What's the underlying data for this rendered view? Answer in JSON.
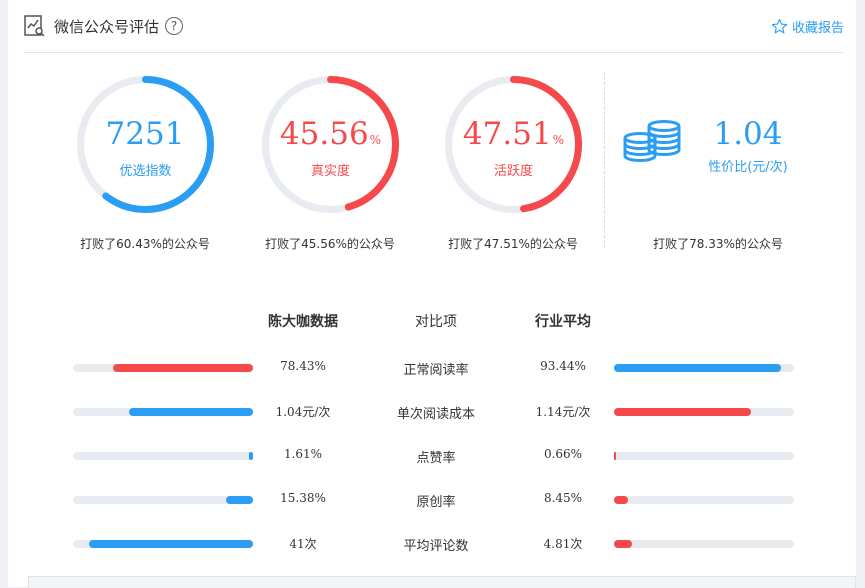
{
  "header": {
    "title": "微信公众号评估",
    "help_glyph": "?",
    "favorite_label": "收藏报告"
  },
  "colors": {
    "blue": "#2a9df4",
    "red": "#f5494b",
    "track": "#e8ebf0"
  },
  "gauges": [
    {
      "value": "7251",
      "unit": "",
      "label": "优选指数",
      "fraction": 0.6043,
      "color": "#2a9df4",
      "beat": "打败了60.43%的公众号"
    },
    {
      "value": "45.56",
      "unit": "%",
      "label": "真实度",
      "fraction": 0.4556,
      "color": "#f5494b",
      "beat": "打败了45.56%的公众号"
    },
    {
      "value": "47.51",
      "unit": "%",
      "label": "活跃度",
      "fraction": 0.4751,
      "color": "#f5494b",
      "beat": "打败了47.51%的公众号"
    }
  ],
  "cost": {
    "value": "1.04",
    "label": "性价比(元/次)",
    "beat": "打败了78.33%的公众号",
    "icon": "coins-stack-icon"
  },
  "compare": {
    "headers": {
      "own": "陈大咖数据",
      "metric": "对比项",
      "avg": "行业平均"
    },
    "rows": [
      {
        "own": "78.43%",
        "metric": "正常阅读率",
        "avg": "93.44%",
        "own_fill": 0.78,
        "own_color": "#f5494b",
        "avg_fill": 0.93,
        "avg_color": "#2a9df4"
      },
      {
        "own": "1.04元/次",
        "metric": "单次阅读成本",
        "avg": "1.14元/次",
        "own_fill": 0.69,
        "own_color": "#2a9df4",
        "avg_fill": 0.76,
        "avg_color": "#f5494b"
      },
      {
        "own": "1.61%",
        "metric": "点赞率",
        "avg": "0.66%",
        "own_fill": 0.02,
        "own_color": "#2a9df4",
        "avg_fill": 0.01,
        "avg_color": "#f5494b"
      },
      {
        "own": "15.38%",
        "metric": "原创率",
        "avg": "8.45%",
        "own_fill": 0.15,
        "own_color": "#2a9df4",
        "avg_fill": 0.08,
        "avg_color": "#f5494b"
      },
      {
        "own": "41次",
        "metric": "平均评论数",
        "avg": "4.81次",
        "own_fill": 0.91,
        "own_color": "#2a9df4",
        "avg_fill": 0.1,
        "avg_color": "#f5494b"
      }
    ]
  }
}
